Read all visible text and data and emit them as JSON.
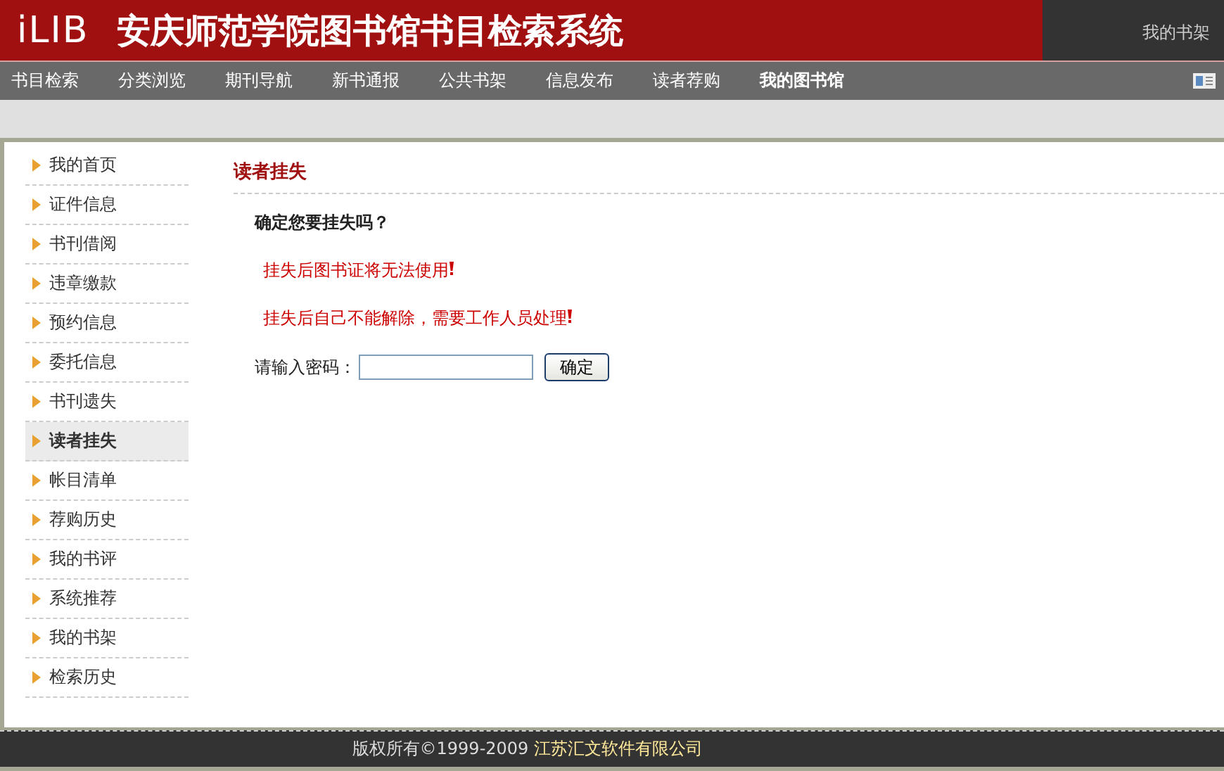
{
  "header": {
    "logo": "iLIB",
    "title": "安庆师范学院图书馆书目检索系统",
    "user_links": [
      "我的书架"
    ]
  },
  "nav": [
    {
      "label": "书目检索",
      "selected": false
    },
    {
      "label": "分类浏览",
      "selected": false
    },
    {
      "label": "期刊导航",
      "selected": false
    },
    {
      "label": "新书通报",
      "selected": false
    },
    {
      "label": "公共书架",
      "selected": false
    },
    {
      "label": "信息发布",
      "selected": false
    },
    {
      "label": "读者荐购",
      "selected": false
    },
    {
      "label": "我的图书馆",
      "selected": true
    }
  ],
  "sidebar": {
    "items": [
      {
        "label": "我的首页",
        "selected": false
      },
      {
        "label": "证件信息",
        "selected": false
      },
      {
        "label": "书刊借阅",
        "selected": false
      },
      {
        "label": "违章缴款",
        "selected": false
      },
      {
        "label": "预约信息",
        "selected": false
      },
      {
        "label": "委托信息",
        "selected": false
      },
      {
        "label": "书刊遗失",
        "selected": false
      },
      {
        "label": "读者挂失",
        "selected": true
      },
      {
        "label": "帐目清单",
        "selected": false
      },
      {
        "label": "荐购历史",
        "selected": false
      },
      {
        "label": "我的书评",
        "selected": false
      },
      {
        "label": "系统推荐",
        "selected": false
      },
      {
        "label": "我的书架",
        "selected": false
      },
      {
        "label": "检索历史",
        "selected": false
      }
    ]
  },
  "main": {
    "heading": "读者挂失",
    "question": "确定您要挂失吗？",
    "warnings": [
      "挂失后图书证将无法使用",
      "挂失后自己不能解除，需要工作人员处理"
    ],
    "password_label": "请输入密码：",
    "submit": "确定"
  },
  "footer": {
    "copyright": "版权所有©1999-2009",
    "company": "江苏汇文软件有限公司"
  }
}
